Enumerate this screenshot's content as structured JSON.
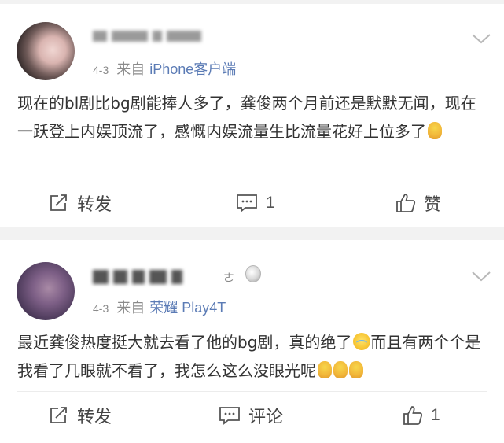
{
  "posts": [
    {
      "date": "4-3",
      "from_label": "来自",
      "source": "iPhone客户端",
      "content": "现在的bl剧比bg剧能捧人多了，龚俊两个月前还是默默无闻，现在一跃登上内娱顶流了，感慨内娱流量生比流量花好上位多了",
      "emoji_icons": [
        "pray-emoji-icon"
      ],
      "actions": {
        "repost_label": "转发",
        "comment_count": "1",
        "like_label": "赞"
      }
    },
    {
      "date": "4-3",
      "from_label": "来自",
      "source": "荣耀 Play4T",
      "content": "最近龚俊热度挺大就去看了他的bg剧，真的绝了",
      "content_after_emoji": "而且有两个个是我看了几眼就不看了，我怎么这么没眼光呢",
      "emoji_icons": [
        "sob-emoji-icon",
        "pray-emoji-icon",
        "pray-emoji-icon",
        "pray-emoji-icon"
      ],
      "actions": {
        "repost_label": "转发",
        "comment_label": "评论",
        "like_count": "1"
      }
    }
  ],
  "colors": {
    "source_link": "#5b7bb5",
    "meta_text": "#8a8a8a",
    "body_text": "#333333",
    "separator_band": "#f2f2f2"
  },
  "icons": [
    "chevron-down-icon",
    "repost-icon",
    "comment-icon",
    "like-icon",
    "medal-icon"
  ]
}
